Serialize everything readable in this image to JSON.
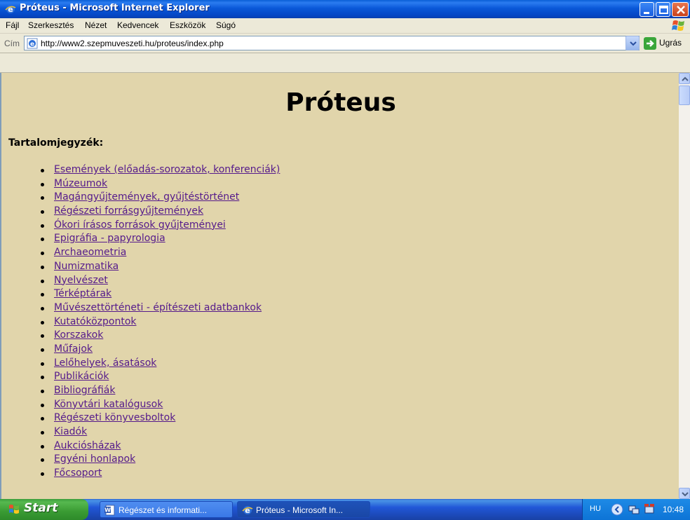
{
  "window": {
    "title": "Próteus - Microsoft Internet Explorer"
  },
  "menubar": {
    "items": [
      "Fájl",
      "Szerkesztés",
      "Nézet",
      "Kedvencek",
      "Eszközök",
      "Súgó"
    ]
  },
  "addressbar": {
    "label": "Cím",
    "url": "http://www2.szepmuveszeti.hu/proteus/index.php",
    "go_label": "Ugrás"
  },
  "page": {
    "title": "Próteus",
    "toc_heading": "Tartalomjegyzék:",
    "links": [
      "Események (előadás-sorozatok, konferenciák)",
      "Múzeumok",
      "Magángyűjtemények, gyűjtéstörténet",
      "Régészeti forrásgyűjtemények",
      "Ókori írásos források gyűjteményei",
      "Epigráfia - papyrologia",
      "Archaeometria",
      "Numizmatika",
      "Nyelvészet",
      "Térképtárak",
      "Művészettörténeti - építészeti adatbankok",
      "Kutatóközpontok",
      "Korszakok",
      "Műfajok",
      "Lelőhelyek, ásatások",
      "Publikációk",
      "Bibliográfiák",
      "Könyvtári katalógusok",
      "Régészeti könyvesboltok",
      "Kiadók",
      "Aukciósházak",
      "Egyéni honlapok",
      "Főcsoport"
    ],
    "background_color": "#e1d5ab",
    "link_color": "#551a8b"
  },
  "taskbar": {
    "start_label": "Start",
    "tasks": [
      {
        "label": "Régészet és informati...",
        "icon": "word-doc-icon",
        "active": false
      },
      {
        "label": "Próteus - Microsoft In...",
        "icon": "ie-icon",
        "active": true
      }
    ],
    "language": "HU",
    "clock": "10:48"
  }
}
